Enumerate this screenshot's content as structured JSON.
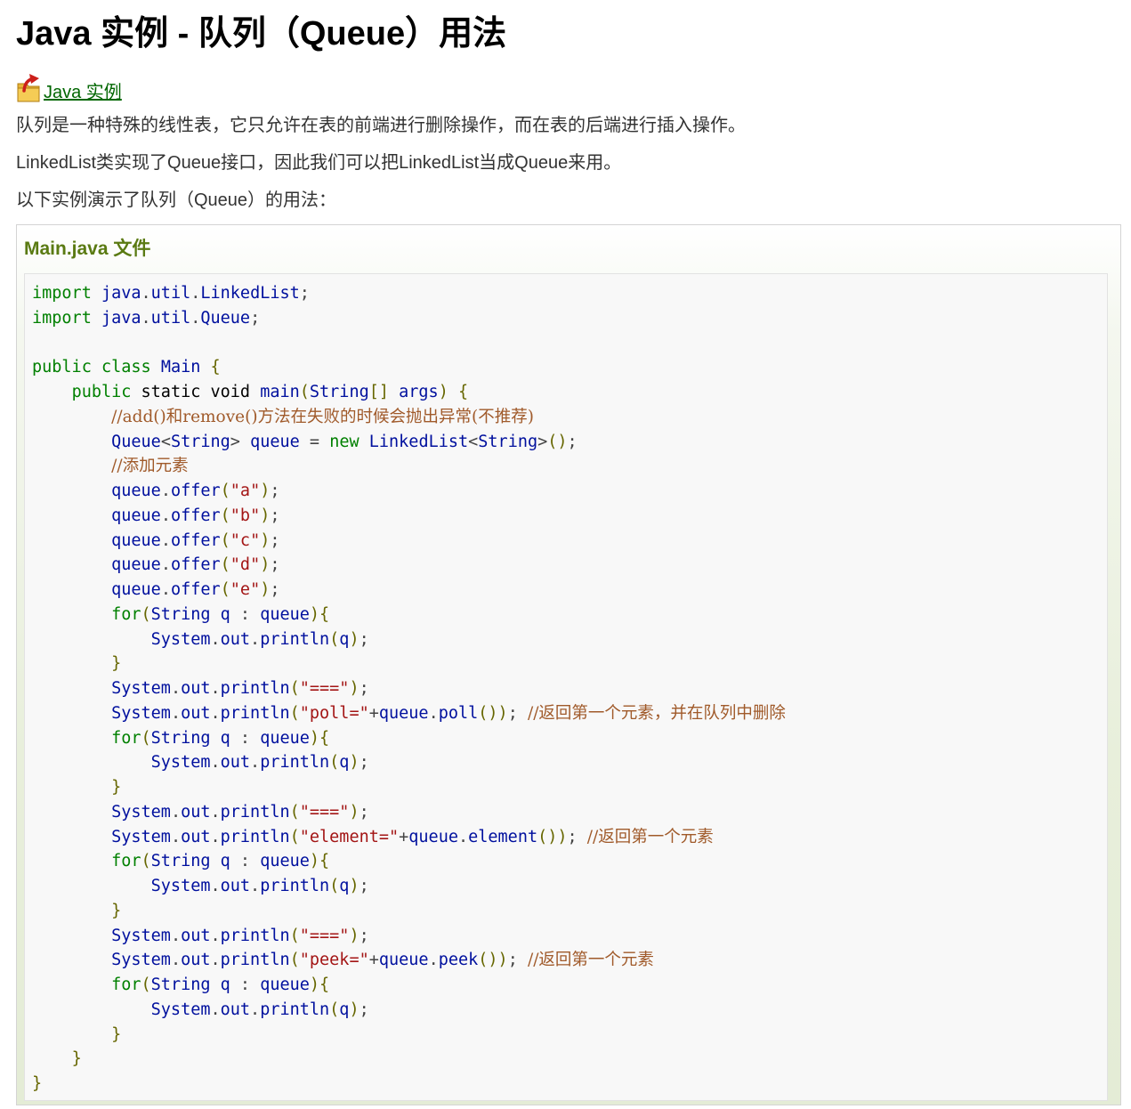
{
  "page_title": "Java 实例 - 队列（Queue）用法",
  "back_link": {
    "label": "Java 实例",
    "icon": "folder-up-icon"
  },
  "paragraphs": [
    "队列是一种特殊的线性表，它只允许在表的前端进行删除操作，而在表的后端进行插入操作。",
    "LinkedList类实现了Queue接口，因此我们可以把LinkedList当成Queue来用。",
    "以下实例演示了队列（Queue）的用法："
  ],
  "example": {
    "title": "Main.java 文件",
    "code_lines": [
      [
        [
          "kw",
          "import"
        ],
        [
          "pl",
          " "
        ],
        [
          "id",
          "java"
        ],
        [
          "op",
          "."
        ],
        [
          "id",
          "util"
        ],
        [
          "op",
          "."
        ],
        [
          "id",
          "LinkedList"
        ],
        [
          "op",
          ";"
        ]
      ],
      [
        [
          "kw",
          "import"
        ],
        [
          "pl",
          " "
        ],
        [
          "id",
          "java"
        ],
        [
          "op",
          "."
        ],
        [
          "id",
          "util"
        ],
        [
          "op",
          "."
        ],
        [
          "id",
          "Queue"
        ],
        [
          "op",
          ";"
        ]
      ],
      [],
      [
        [
          "kw",
          "public"
        ],
        [
          "pl",
          " "
        ],
        [
          "kw",
          "class"
        ],
        [
          "pl",
          " "
        ],
        [
          "id",
          "Main"
        ],
        [
          "pl",
          " "
        ],
        [
          "pn",
          "{"
        ]
      ],
      [
        [
          "pl",
          "    "
        ],
        [
          "kw",
          "public"
        ],
        [
          "pl",
          " static void "
        ],
        [
          "id",
          "main"
        ],
        [
          "pn",
          "("
        ],
        [
          "id",
          "String"
        ],
        [
          "pn",
          "[]"
        ],
        [
          "pl",
          " "
        ],
        [
          "id",
          "args"
        ],
        [
          "pn",
          ")"
        ],
        [
          "pl",
          " "
        ],
        [
          "pn",
          "{"
        ]
      ],
      [
        [
          "pl",
          "        "
        ],
        [
          "cm",
          "//add()和remove()方法在失败的时候会抛出异常(不推荐)"
        ]
      ],
      [
        [
          "pl",
          "        "
        ],
        [
          "id",
          "Queue"
        ],
        [
          "op",
          "<"
        ],
        [
          "id",
          "String"
        ],
        [
          "op",
          ">"
        ],
        [
          "pl",
          " "
        ],
        [
          "id",
          "queue"
        ],
        [
          "pl",
          " "
        ],
        [
          "op",
          "="
        ],
        [
          "pl",
          " "
        ],
        [
          "kw",
          "new"
        ],
        [
          "pl",
          " "
        ],
        [
          "id",
          "LinkedList"
        ],
        [
          "op",
          "<"
        ],
        [
          "id",
          "String"
        ],
        [
          "op",
          ">"
        ],
        [
          "pn",
          "()"
        ],
        [
          "op",
          ";"
        ]
      ],
      [
        [
          "pl",
          "        "
        ],
        [
          "cm",
          "//添加元素"
        ]
      ],
      [
        [
          "pl",
          "        "
        ],
        [
          "id",
          "queue"
        ],
        [
          "op",
          "."
        ],
        [
          "id",
          "offer"
        ],
        [
          "pn",
          "("
        ],
        [
          "str",
          "\"a\""
        ],
        [
          "pn",
          ")"
        ],
        [
          "op",
          ";"
        ]
      ],
      [
        [
          "pl",
          "        "
        ],
        [
          "id",
          "queue"
        ],
        [
          "op",
          "."
        ],
        [
          "id",
          "offer"
        ],
        [
          "pn",
          "("
        ],
        [
          "str",
          "\"b\""
        ],
        [
          "pn",
          ")"
        ],
        [
          "op",
          ";"
        ]
      ],
      [
        [
          "pl",
          "        "
        ],
        [
          "id",
          "queue"
        ],
        [
          "op",
          "."
        ],
        [
          "id",
          "offer"
        ],
        [
          "pn",
          "("
        ],
        [
          "str",
          "\"c\""
        ],
        [
          "pn",
          ")"
        ],
        [
          "op",
          ";"
        ]
      ],
      [
        [
          "pl",
          "        "
        ],
        [
          "id",
          "queue"
        ],
        [
          "op",
          "."
        ],
        [
          "id",
          "offer"
        ],
        [
          "pn",
          "("
        ],
        [
          "str",
          "\"d\""
        ],
        [
          "pn",
          ")"
        ],
        [
          "op",
          ";"
        ]
      ],
      [
        [
          "pl",
          "        "
        ],
        [
          "id",
          "queue"
        ],
        [
          "op",
          "."
        ],
        [
          "id",
          "offer"
        ],
        [
          "pn",
          "("
        ],
        [
          "str",
          "\"e\""
        ],
        [
          "pn",
          ")"
        ],
        [
          "op",
          ";"
        ]
      ],
      [
        [
          "pl",
          "        "
        ],
        [
          "kw",
          "for"
        ],
        [
          "pn",
          "("
        ],
        [
          "id",
          "String"
        ],
        [
          "pl",
          " "
        ],
        [
          "id",
          "q"
        ],
        [
          "pl",
          " "
        ],
        [
          "op",
          ":"
        ],
        [
          "pl",
          " "
        ],
        [
          "id",
          "queue"
        ],
        [
          "pn",
          "){"
        ]
      ],
      [
        [
          "pl",
          "            "
        ],
        [
          "id",
          "System"
        ],
        [
          "op",
          "."
        ],
        [
          "id",
          "out"
        ],
        [
          "op",
          "."
        ],
        [
          "id",
          "println"
        ],
        [
          "pn",
          "("
        ],
        [
          "id",
          "q"
        ],
        [
          "pn",
          ")"
        ],
        [
          "op",
          ";"
        ]
      ],
      [
        [
          "pl",
          "        "
        ],
        [
          "pn",
          "}"
        ]
      ],
      [
        [
          "pl",
          "        "
        ],
        [
          "id",
          "System"
        ],
        [
          "op",
          "."
        ],
        [
          "id",
          "out"
        ],
        [
          "op",
          "."
        ],
        [
          "id",
          "println"
        ],
        [
          "pn",
          "("
        ],
        [
          "str",
          "\"===\""
        ],
        [
          "pn",
          ")"
        ],
        [
          "op",
          ";"
        ]
      ],
      [
        [
          "pl",
          "        "
        ],
        [
          "id",
          "System"
        ],
        [
          "op",
          "."
        ],
        [
          "id",
          "out"
        ],
        [
          "op",
          "."
        ],
        [
          "id",
          "println"
        ],
        [
          "pn",
          "("
        ],
        [
          "str",
          "\"poll=\""
        ],
        [
          "op",
          "+"
        ],
        [
          "id",
          "queue"
        ],
        [
          "op",
          "."
        ],
        [
          "id",
          "poll"
        ],
        [
          "pn",
          "())"
        ],
        [
          "op",
          ";"
        ],
        [
          "pl",
          " "
        ],
        [
          "cm",
          "//返回第一个元素，并在队列中删除"
        ]
      ],
      [
        [
          "pl",
          "        "
        ],
        [
          "kw",
          "for"
        ],
        [
          "pn",
          "("
        ],
        [
          "id",
          "String"
        ],
        [
          "pl",
          " "
        ],
        [
          "id",
          "q"
        ],
        [
          "pl",
          " "
        ],
        [
          "op",
          ":"
        ],
        [
          "pl",
          " "
        ],
        [
          "id",
          "queue"
        ],
        [
          "pn",
          "){"
        ]
      ],
      [
        [
          "pl",
          "            "
        ],
        [
          "id",
          "System"
        ],
        [
          "op",
          "."
        ],
        [
          "id",
          "out"
        ],
        [
          "op",
          "."
        ],
        [
          "id",
          "println"
        ],
        [
          "pn",
          "("
        ],
        [
          "id",
          "q"
        ],
        [
          "pn",
          ")"
        ],
        [
          "op",
          ";"
        ]
      ],
      [
        [
          "pl",
          "        "
        ],
        [
          "pn",
          "}"
        ]
      ],
      [
        [
          "pl",
          "        "
        ],
        [
          "id",
          "System"
        ],
        [
          "op",
          "."
        ],
        [
          "id",
          "out"
        ],
        [
          "op",
          "."
        ],
        [
          "id",
          "println"
        ],
        [
          "pn",
          "("
        ],
        [
          "str",
          "\"===\""
        ],
        [
          "pn",
          ")"
        ],
        [
          "op",
          ";"
        ]
      ],
      [
        [
          "pl",
          "        "
        ],
        [
          "id",
          "System"
        ],
        [
          "op",
          "."
        ],
        [
          "id",
          "out"
        ],
        [
          "op",
          "."
        ],
        [
          "id",
          "println"
        ],
        [
          "pn",
          "("
        ],
        [
          "str",
          "\"element=\""
        ],
        [
          "op",
          "+"
        ],
        [
          "id",
          "queue"
        ],
        [
          "op",
          "."
        ],
        [
          "id",
          "element"
        ],
        [
          "pn",
          "())"
        ],
        [
          "op",
          ";"
        ],
        [
          "pl",
          " "
        ],
        [
          "cm",
          "//返回第一个元素"
        ]
      ],
      [
        [
          "pl",
          "        "
        ],
        [
          "kw",
          "for"
        ],
        [
          "pn",
          "("
        ],
        [
          "id",
          "String"
        ],
        [
          "pl",
          " "
        ],
        [
          "id",
          "q"
        ],
        [
          "pl",
          " "
        ],
        [
          "op",
          ":"
        ],
        [
          "pl",
          " "
        ],
        [
          "id",
          "queue"
        ],
        [
          "pn",
          "){"
        ]
      ],
      [
        [
          "pl",
          "            "
        ],
        [
          "id",
          "System"
        ],
        [
          "op",
          "."
        ],
        [
          "id",
          "out"
        ],
        [
          "op",
          "."
        ],
        [
          "id",
          "println"
        ],
        [
          "pn",
          "("
        ],
        [
          "id",
          "q"
        ],
        [
          "pn",
          ")"
        ],
        [
          "op",
          ";"
        ]
      ],
      [
        [
          "pl",
          "        "
        ],
        [
          "pn",
          "}"
        ]
      ],
      [
        [
          "pl",
          "        "
        ],
        [
          "id",
          "System"
        ],
        [
          "op",
          "."
        ],
        [
          "id",
          "out"
        ],
        [
          "op",
          "."
        ],
        [
          "id",
          "println"
        ],
        [
          "pn",
          "("
        ],
        [
          "str",
          "\"===\""
        ],
        [
          "pn",
          ")"
        ],
        [
          "op",
          ";"
        ]
      ],
      [
        [
          "pl",
          "        "
        ],
        [
          "id",
          "System"
        ],
        [
          "op",
          "."
        ],
        [
          "id",
          "out"
        ],
        [
          "op",
          "."
        ],
        [
          "id",
          "println"
        ],
        [
          "pn",
          "("
        ],
        [
          "str",
          "\"peek=\""
        ],
        [
          "op",
          "+"
        ],
        [
          "id",
          "queue"
        ],
        [
          "op",
          "."
        ],
        [
          "id",
          "peek"
        ],
        [
          "pn",
          "())"
        ],
        [
          "op",
          ";"
        ],
        [
          "pl",
          " "
        ],
        [
          "cm",
          "//返回第一个元素"
        ]
      ],
      [
        [
          "pl",
          "        "
        ],
        [
          "kw",
          "for"
        ],
        [
          "pn",
          "("
        ],
        [
          "id",
          "String"
        ],
        [
          "pl",
          " "
        ],
        [
          "id",
          "q"
        ],
        [
          "pl",
          " "
        ],
        [
          "op",
          ":"
        ],
        [
          "pl",
          " "
        ],
        [
          "id",
          "queue"
        ],
        [
          "pn",
          "){"
        ]
      ],
      [
        [
          "pl",
          "            "
        ],
        [
          "id",
          "System"
        ],
        [
          "op",
          "."
        ],
        [
          "id",
          "out"
        ],
        [
          "op",
          "."
        ],
        [
          "id",
          "println"
        ],
        [
          "pn",
          "("
        ],
        [
          "id",
          "q"
        ],
        [
          "pn",
          ")"
        ],
        [
          "op",
          ";"
        ]
      ],
      [
        [
          "pl",
          "        "
        ],
        [
          "pn",
          "}"
        ]
      ],
      [
        [
          "pl",
          "    "
        ],
        [
          "pn",
          "}"
        ]
      ],
      [
        [
          "pn",
          "}"
        ]
      ]
    ]
  },
  "colors": {
    "link": "#006600",
    "example_title": "#5a7a12",
    "keyword": "#008000",
    "identifier": "#00109e",
    "string": "#a31515",
    "comment": "#a05a2a"
  }
}
